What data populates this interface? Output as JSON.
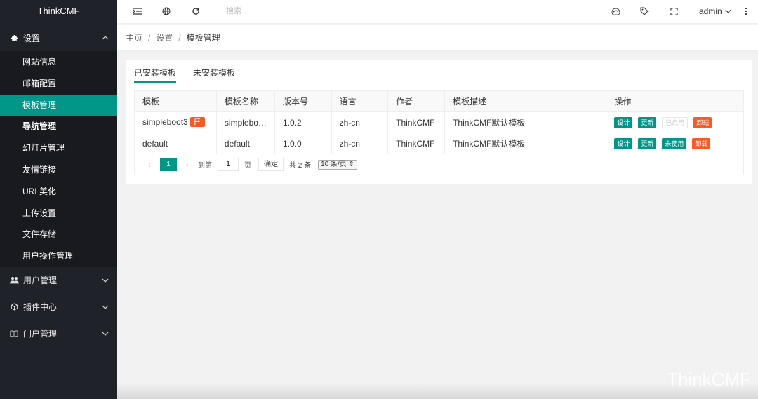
{
  "app": {
    "logo": "ThinkCMF",
    "watermark": "ThinkCMF"
  },
  "sidebar": {
    "groups": [
      {
        "label": "设置",
        "icon": "gear-icon",
        "expanded": true,
        "items": [
          {
            "label": "网站信息"
          },
          {
            "label": "邮箱配置"
          },
          {
            "label": "模板管理",
            "active": true
          },
          {
            "label": "导航管理"
          },
          {
            "label": "幻灯片管理"
          },
          {
            "label": "友情链接"
          },
          {
            "label": "URL美化"
          },
          {
            "label": "上传设置"
          },
          {
            "label": "文件存储"
          },
          {
            "label": "用户操作管理"
          }
        ]
      },
      {
        "label": "用户管理",
        "icon": "users-icon"
      },
      {
        "label": "插件中心",
        "icon": "plugin-icon"
      },
      {
        "label": "门户管理",
        "icon": "book-icon"
      }
    ]
  },
  "header": {
    "search_placeholder": "搜索...",
    "user": "admin"
  },
  "breadcrumb": {
    "home": "主页",
    "level1": "设置",
    "current": "模板管理",
    "sep": "/"
  },
  "tabs": [
    {
      "label": "已安装模板",
      "active": true
    },
    {
      "label": "未安装模板"
    }
  ],
  "table": {
    "columns": [
      "模板",
      "模板名称",
      "版本号",
      "语言",
      "作者",
      "模板描述",
      "操作"
    ],
    "rows": [
      {
        "template": "simpleboot3",
        "name": "simplebo…",
        "version": "1.0.2",
        "lang": "zh-cn",
        "author": "ThinkCMF",
        "desc": "ThinkCMF默认模板",
        "actions": {
          "design": "设计",
          "update": "更新",
          "enable": "已启用",
          "uninstall": "卸载"
        }
      },
      {
        "template": "default",
        "name": "default",
        "version": "1.0.0",
        "lang": "zh-cn",
        "author": "ThinkCMF",
        "desc": "ThinkCMF默认模板",
        "actions": {
          "design": "设计",
          "update": "更新",
          "enable": "未使用",
          "uninstall": "卸载"
        }
      }
    ]
  },
  "pager": {
    "current": "1",
    "goto_label": "到第",
    "goto_value": "1",
    "page_unit": "页",
    "confirm": "确定",
    "total": "共 2 条",
    "page_size": "10 条/页"
  },
  "colors": {
    "accent": "#009688",
    "danger": "#ff5722",
    "sidebar": "#20222a"
  }
}
